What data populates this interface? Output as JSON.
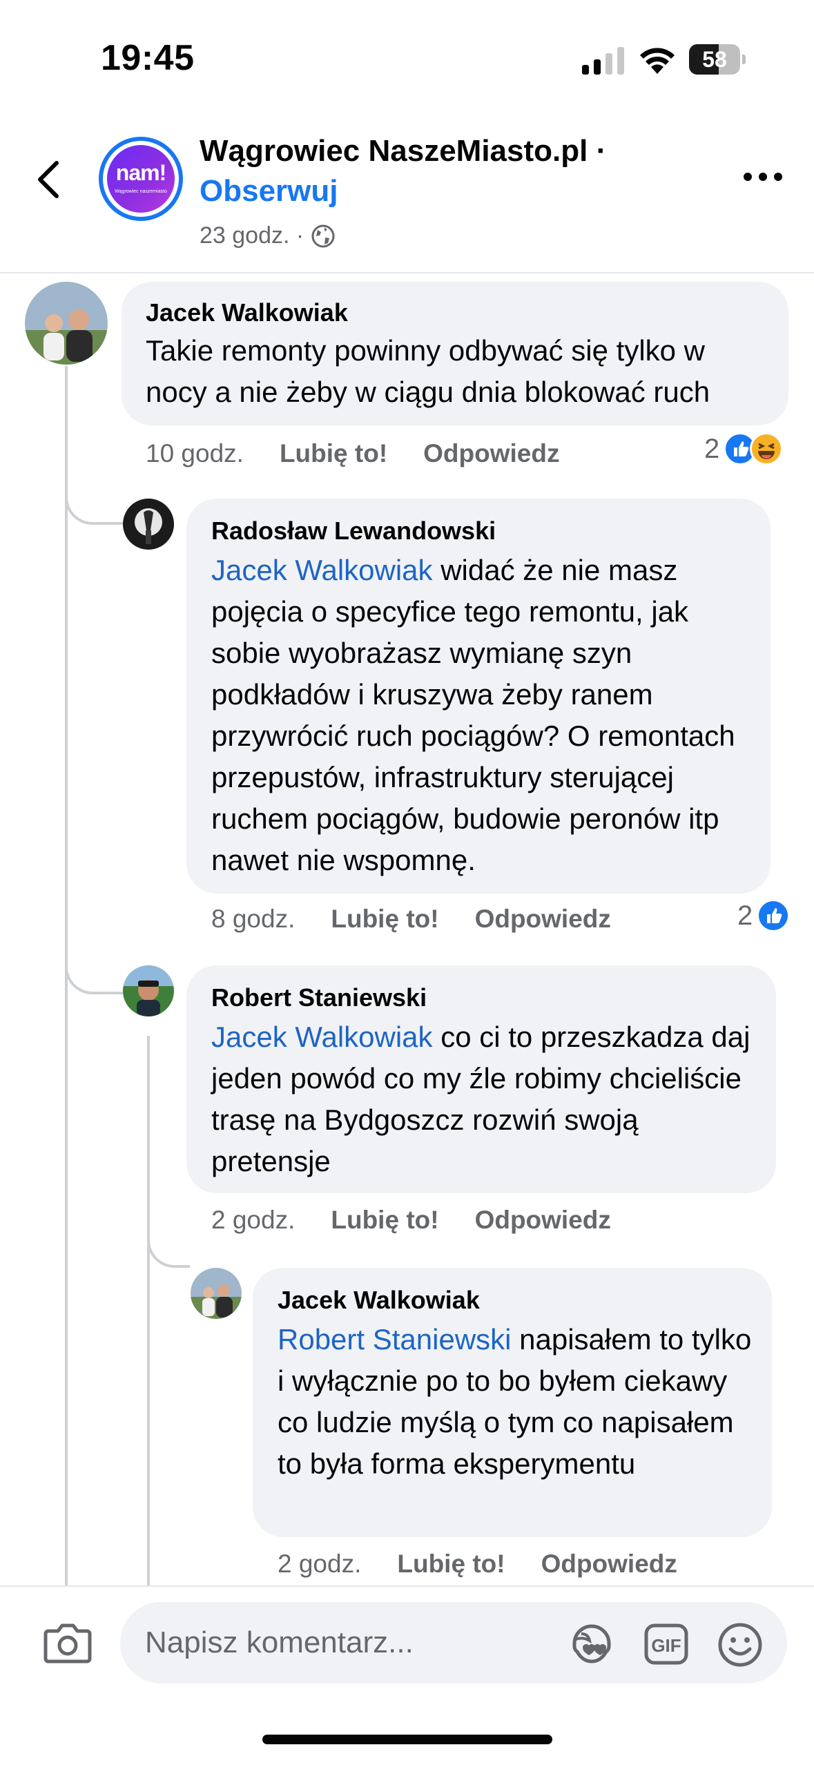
{
  "status_bar": {
    "time": "19:45",
    "battery": "58",
    "battery_level": 0.58
  },
  "header": {
    "page_name": "Wągrowiec NaszeMiasto.pl ·",
    "follow_label": "Obserwuj",
    "post_time": "23 godz. ·",
    "avatar_logo": "nam!",
    "avatar_sub": "Wągrowiec naszemiasto"
  },
  "comments": [
    {
      "author": "Jacek Walkowiak",
      "text": "Takie remonty powinny odbywać się tylko w nocy a nie żeby w ciągu dnia blokować ruch",
      "time": "10 godz.",
      "like_label": "Lubię to!",
      "reply_label": "Odpowiedz",
      "reaction_count": "2",
      "reactions": [
        "like-icon",
        "haha-icon"
      ]
    },
    {
      "author": "Radosław Lewandowski",
      "mention": "Jacek Walkowiak",
      "text": " widać że nie masz pojęcia o specyfice tego remontu, jak sobie wyobrażasz wymianę szyn podkładów i kruszywa żeby ranem przywrócić ruch pociągów? O remontach przepustów, infrastruktury sterującej ruchem pociągów, budowie peronów itp nawet nie wspomnę.",
      "time": "8 godz.",
      "like_label": "Lubię to!",
      "reply_label": "Odpowiedz",
      "reaction_count": "2",
      "reactions": [
        "like-icon"
      ]
    },
    {
      "author": "Robert Staniewski",
      "mention": "Jacek Walkowiak",
      "text": " co ci to przeszkadza daj jeden powód co my źle robimy chcieliście trasę na Bydgoszcz rozwiń swoją pretensje",
      "time": "2 godz.",
      "like_label": "Lubię to!",
      "reply_label": "Odpowiedz"
    },
    {
      "author": "Jacek Walkowiak",
      "mention": "Robert Staniewski",
      "text": " napisałem to tylko i wyłącznie po to bo byłem ciekawy co ludzie myślą o tym co napisałem to była forma eksperymentu",
      "time": "2 godz.",
      "like_label": "Lubię to!",
      "reply_label": "Odpowiedz"
    }
  ],
  "composer": {
    "placeholder": "Napisz komentarz...",
    "icons": [
      "camera-icon",
      "avatar-sticker-icon",
      "gif-icon",
      "emoji-icon"
    ],
    "gif_label": "GIF"
  },
  "colors": {
    "accent": "#1877f2",
    "mention": "#1d64c4",
    "bubble": "#f0f2f5",
    "secondary_text": "#65676b"
  }
}
